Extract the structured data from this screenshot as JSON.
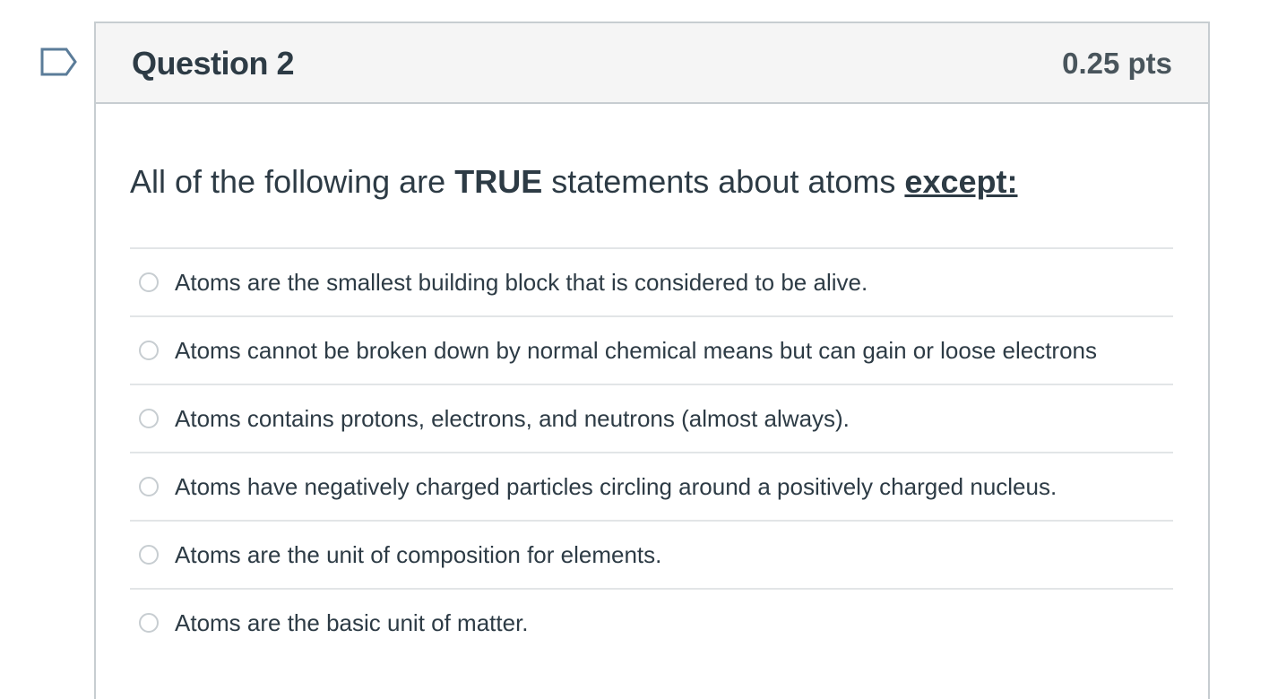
{
  "question": {
    "title": "Question 2",
    "points": "0.25 pts",
    "text": {
      "part1": "All of the following are ",
      "strong": "TRUE",
      "part2": " statements about atoms ",
      "emphasis": "except:"
    },
    "answers": [
      {
        "label": "Atoms are the smallest building block that is considered to be alive.",
        "selected": false
      },
      {
        "label": "Atoms cannot be broken down by normal chemical means but can gain or loose electrons",
        "selected": false
      },
      {
        "label": "Atoms contains protons, electrons, and neutrons (almost always).",
        "selected": false
      },
      {
        "label": "Atoms have negatively charged particles circling around a positively charged nucleus.",
        "selected": false
      },
      {
        "label": "Atoms are the unit of composition for elements.",
        "selected": false
      },
      {
        "label": "Atoms are the basic unit of matter.",
        "selected": false
      }
    ]
  },
  "flag": {
    "icon": "flag-question-icon",
    "color": "#5b7c99"
  },
  "colors": {
    "text": "#2d3b45",
    "border": "#c7cdd1",
    "header_bg": "#f5f5f5",
    "divider": "#e2e5e7"
  }
}
